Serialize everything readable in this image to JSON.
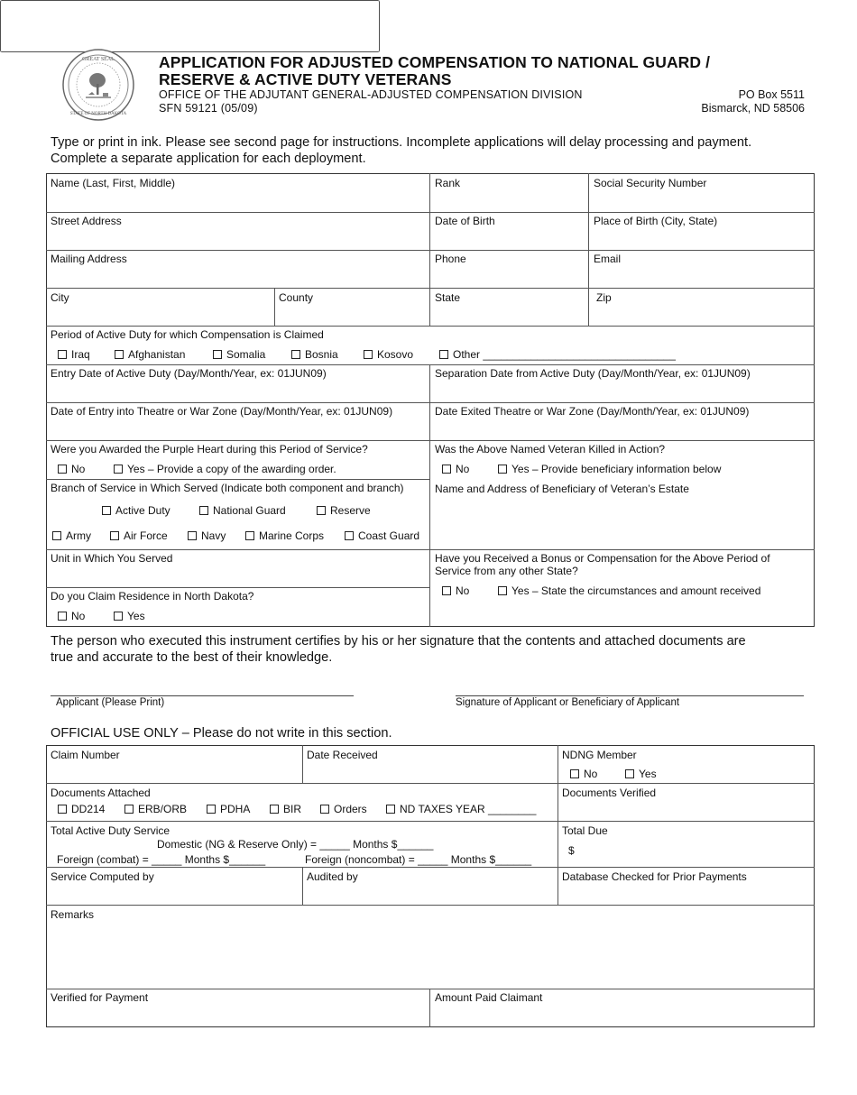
{
  "header": {
    "seal_icon": "great-seal-state-of-north-dakota",
    "seal_top_text": "GREAT SEAL",
    "seal_bottom_text": "STATE OF NORTH DAKOTA",
    "title_line1": "APPLICATION FOR ADJUSTED COMPENSATION TO NATIONAL GUARD /",
    "title_line2": "RESERVE & ACTIVE DUTY VETERANS",
    "office": "OFFICE OF THE ADJUTANT GENERAL-ADJUSTED COMPENSATION DIVISION",
    "form_number": "SFN 59121 (05/09)",
    "po_box": "PO Box 5511",
    "city_state": "Bismarck, ND 58506"
  },
  "intro": {
    "line1": "Type or print in ink. Please see second page for instructions.  Incomplete applications will delay processing and payment.",
    "line2": "Complete a separate application for each deployment."
  },
  "applicant": {
    "name": "Name (Last, First, Middle)",
    "rank": "Rank",
    "ssn": "Social Security Number",
    "street": "Street Address",
    "dob": "Date of Birth",
    "pob": "Place of Birth (City, State)",
    "mailing": "Mailing Address",
    "phone": "Phone",
    "email": "Email",
    "city": "City",
    "county": "County",
    "state": "State",
    "zip": "Zip"
  },
  "period": {
    "label": "Period of Active Duty for which Compensation is Claimed",
    "options": [
      "Iraq",
      "Afghanistan",
      "Somalia",
      "Bosnia",
      "Kosovo",
      "Other ________________________________"
    ]
  },
  "dates": {
    "entry": "Entry Date of Active Duty (Day/Month/Year, ex: 01JUN09)",
    "separation": "Separation Date from Active Duty (Day/Month/Year, ex: 01JUN09)",
    "theatre_entry": "Date of Entry into Theatre or War Zone (Day/Month/Year, ex: 01JUN09)",
    "theatre_exit": "Date Exited Theatre or War Zone (Day/Month/Year, ex: 01JUN09)"
  },
  "purple_heart": {
    "question": "Were you Awarded the Purple Heart during this Period of Service?",
    "no": "No",
    "yes": "Yes – Provide a copy of the awarding order."
  },
  "kia": {
    "question": "Was the Above Named Veteran Killed in Action?",
    "no": "No",
    "yes": "Yes – Provide beneficiary information below",
    "beneficiary": "Name and Address of Beneficiary of Veteran’s Estate"
  },
  "branch": {
    "label": "Branch of Service in Which Served (Indicate both component and branch)",
    "components": [
      "Active Duty",
      "National Guard",
      "Reserve"
    ],
    "branches": [
      "Army",
      "Air Force",
      "Navy",
      "Marine Corps",
      "Coast Guard"
    ]
  },
  "unit": {
    "label": "Unit in Which You Served"
  },
  "residence": {
    "question": "Do you Claim Residence in North Dakota?",
    "no": "No",
    "yes": "Yes"
  },
  "bonus": {
    "question_line1": "Have you Received a Bonus or Compensation for the Above Period of",
    "question_line2": "Service from any other State?",
    "no": "No",
    "yes": "Yes – State the circumstances and amount received"
  },
  "certification": {
    "line1": "The person who executed this instrument certifies by his or her signature that the contents and attached documents are",
    "line2": "true and accurate to the best of their knowledge."
  },
  "signatures": {
    "applicant_print": "Applicant (Please Print)",
    "signature": "Signature of Applicant or Beneficiary of Applicant"
  },
  "official": {
    "heading": "OFFICIAL USE ONLY – Please do not write in this section.",
    "claim_number": "Claim Number",
    "date_received": "Date Received",
    "ndng_member": "NDNG Member",
    "ndng_no": "No",
    "ndng_yes": "Yes",
    "docs_attached": "Documents Attached",
    "docs_options": [
      "DD214",
      "ERB/ORB",
      "PDHA",
      "BIR",
      "Orders",
      "ND TAXES YEAR ________"
    ],
    "docs_verified": "Documents Verified",
    "total_service": "Total Active Duty Service",
    "domestic": "Domestic (NG & Reserve Only) = _____ Months $______",
    "foreign_combat": "Foreign (combat)  = _____ Months $______",
    "foreign_noncombat": "Foreign (noncombat)  = _____ Months $______",
    "total_due": "Total Due",
    "dollar": "$",
    "service_computed": "Service Computed by",
    "audited_by": "Audited by",
    "database_checked": "Database Checked for Prior Payments",
    "remarks": "Remarks",
    "verified_payment": "Verified for Payment",
    "amount_paid": "Amount Paid Claimant"
  }
}
